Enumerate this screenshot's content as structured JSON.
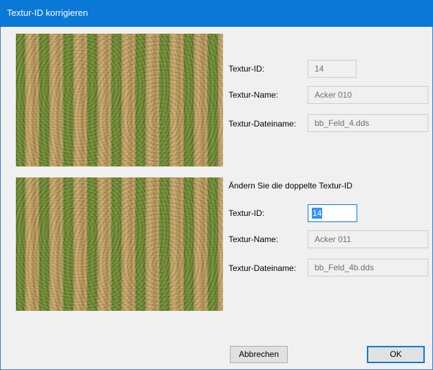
{
  "window": {
    "title": "Textur-ID korrigieren"
  },
  "existing_texture": {
    "id_label": "Textur-ID:",
    "id_value": "14",
    "name_label": "Textur-Name:",
    "name_value": "Acker 010",
    "filename_label": "Textur-Dateiname:",
    "filename_value": "bb_Feld_4.dds"
  },
  "duplicate_texture": {
    "heading": "Ändern Sie die doppelte Textur-ID",
    "id_label": "Textur-ID:",
    "id_value": "14",
    "name_label": "Textur-Name:",
    "name_value": "Acker 011",
    "filename_label": "Textur-Dateiname:",
    "filename_value": "bb_Feld_4b.dds"
  },
  "buttons": {
    "cancel": "Abbrechen",
    "ok": "OK"
  },
  "colors": {
    "titlebar": "#0a78d7",
    "focus": "#0078d7",
    "selection": "#3390ff"
  }
}
